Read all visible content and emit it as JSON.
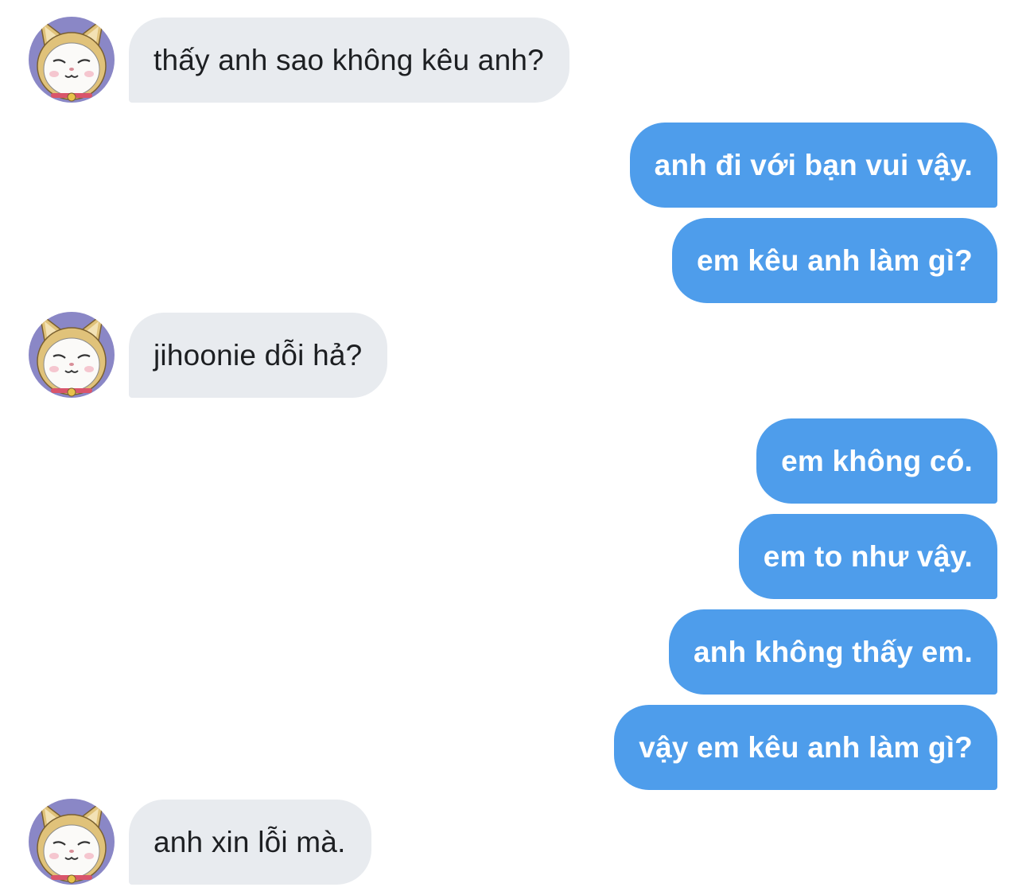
{
  "conversation": {
    "avatar_icon": "cat-avatar-icon",
    "colors": {
      "incoming_bubble": "#e8ebef",
      "incoming_text": "#1d1f22",
      "outgoing_bubble": "#4e9deb",
      "outgoing_text": "#ffffff"
    },
    "messages": [
      {
        "side": "incoming",
        "text": "thấy anh sao không kêu anh?"
      },
      {
        "side": "outgoing",
        "text": "anh đi với bạn vui vậy."
      },
      {
        "side": "outgoing",
        "text": "em kêu anh làm gì?"
      },
      {
        "side": "incoming",
        "text": "jihoonie dỗi hả?"
      },
      {
        "side": "outgoing",
        "text": "em không có."
      },
      {
        "side": "outgoing",
        "text": "em to như vậy."
      },
      {
        "side": "outgoing",
        "text": "anh không thấy em."
      },
      {
        "side": "outgoing",
        "text": "vậy em kêu anh làm gì?"
      },
      {
        "side": "incoming",
        "text": "anh xin lỗi mà."
      }
    ]
  }
}
